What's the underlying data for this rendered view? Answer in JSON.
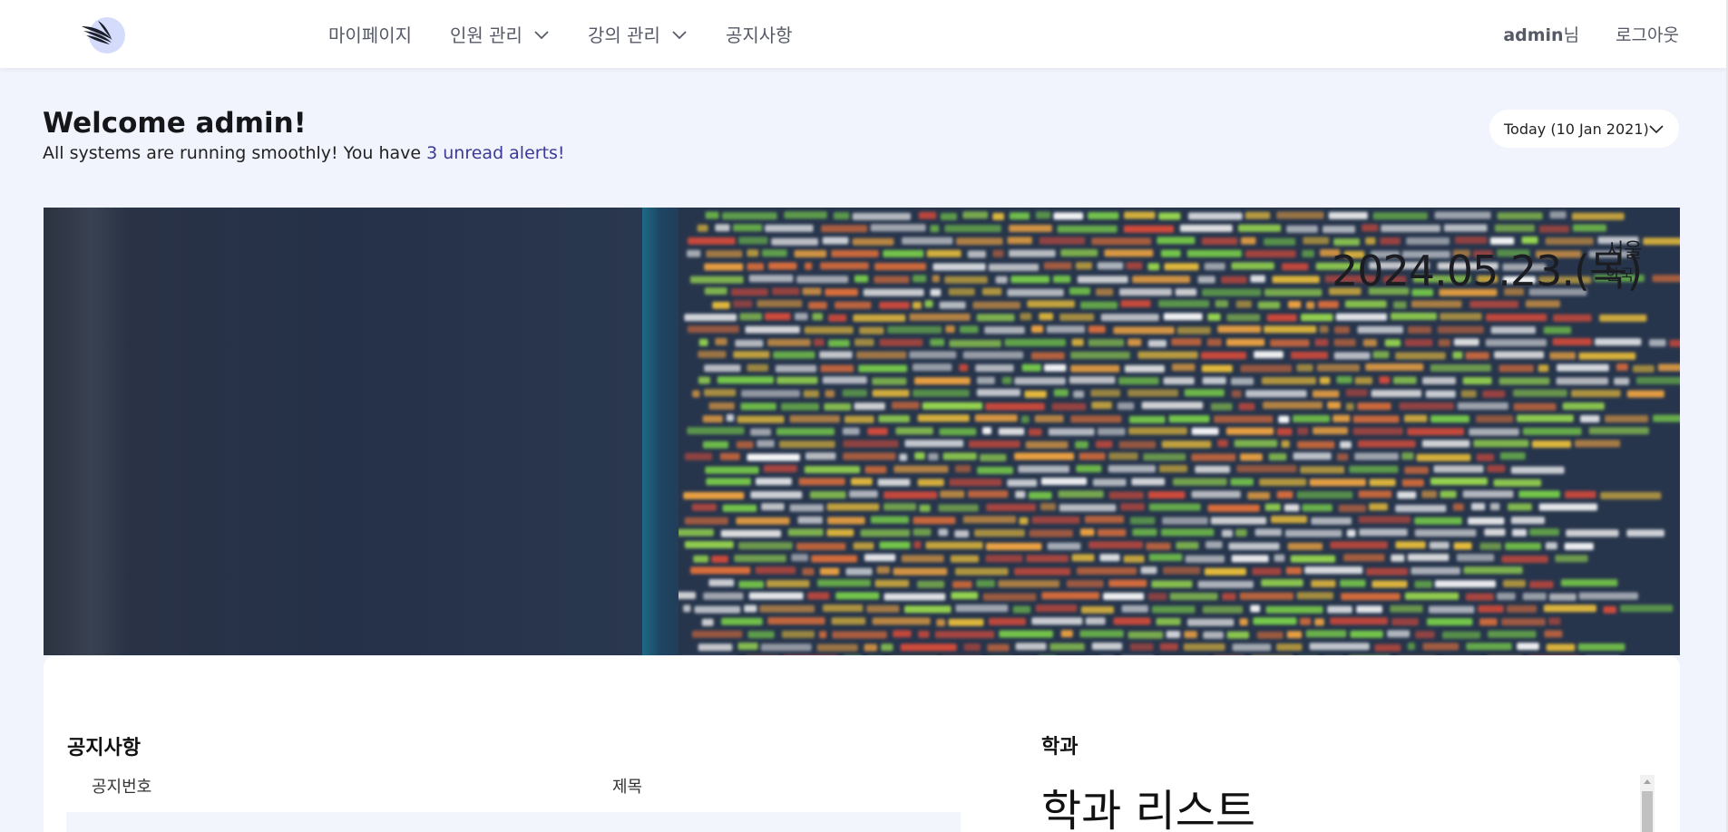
{
  "nav": {
    "logo_icon": "wing-logo-icon",
    "items": [
      {
        "label": "마이페이지",
        "has_dropdown": false
      },
      {
        "label": "인원 관리",
        "has_dropdown": true
      },
      {
        "label": "강의 관리",
        "has_dropdown": true
      },
      {
        "label": "공지사항",
        "has_dropdown": false
      }
    ],
    "user_name": "admin",
    "user_suffix": "님",
    "logout_label": "로그아웃"
  },
  "header": {
    "welcome": "Welcome admin!",
    "subtext_prefix": "All systems are running smoothly! You have ",
    "alerts_link": "3 unread alerts!",
    "date_selector": "Today (10 Jan 2021)"
  },
  "hero": {
    "date": "2024.05.23.(목)",
    "city": "서울",
    "country": "한국"
  },
  "notice": {
    "title": "공지사항",
    "col_number": "공지번호",
    "col_title": "제목"
  },
  "department": {
    "title": "학과",
    "list_heading": "학과 리스트"
  },
  "colors": {
    "background": "#f2f4fd",
    "link": "#3b3a96",
    "logo_disc": "#d5dcfb"
  }
}
